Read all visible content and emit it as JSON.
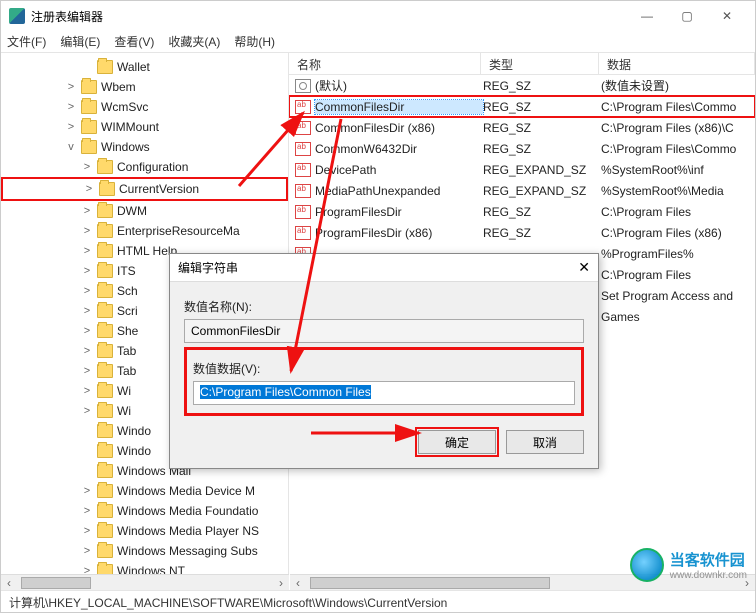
{
  "window": {
    "title": "注册表编辑器"
  },
  "menu": {
    "file": "文件(F)",
    "edit": "编辑(E)",
    "view": "查看(V)",
    "fav": "收藏夹(A)",
    "help": "帮助(H)"
  },
  "tree": [
    {
      "ind": 5,
      "tw": "",
      "label": "Wallet"
    },
    {
      "ind": 4,
      "tw": ">",
      "label": "Wbem"
    },
    {
      "ind": 4,
      "tw": ">",
      "label": "WcmSvc"
    },
    {
      "ind": 4,
      "tw": ">",
      "label": "WIMMount"
    },
    {
      "ind": 4,
      "tw": "v",
      "label": "Windows"
    },
    {
      "ind": 5,
      "tw": ">",
      "label": "Configuration"
    },
    {
      "ind": 5,
      "tw": ">",
      "label": "CurrentVersion",
      "sel": true
    },
    {
      "ind": 5,
      "tw": ">",
      "label": "DWM"
    },
    {
      "ind": 5,
      "tw": ">",
      "label": "EnterpriseResourceMa"
    },
    {
      "ind": 5,
      "tw": ">",
      "label": "HTML Help"
    },
    {
      "ind": 5,
      "tw": ">",
      "label": "ITS"
    },
    {
      "ind": 5,
      "tw": ">",
      "label": "Sch"
    },
    {
      "ind": 5,
      "tw": ">",
      "label": "Scri"
    },
    {
      "ind": 5,
      "tw": ">",
      "label": "She"
    },
    {
      "ind": 5,
      "tw": ">",
      "label": "Tab"
    },
    {
      "ind": 5,
      "tw": ">",
      "label": "Tab"
    },
    {
      "ind": 5,
      "tw": ">",
      "label": "Wi"
    },
    {
      "ind": 5,
      "tw": ">",
      "label": "Wi"
    },
    {
      "ind": 5,
      "tw": "",
      "label": "Windo"
    },
    {
      "ind": 5,
      "tw": "",
      "label": "Windo"
    },
    {
      "ind": 5,
      "tw": "",
      "label": "Windows Mail"
    },
    {
      "ind": 5,
      "tw": ">",
      "label": "Windows Media Device M"
    },
    {
      "ind": 5,
      "tw": ">",
      "label": "Windows Media Foundatio"
    },
    {
      "ind": 5,
      "tw": ">",
      "label": "Windows Media Player NS"
    },
    {
      "ind": 5,
      "tw": ">",
      "label": "Windows Messaging Subs"
    },
    {
      "ind": 5,
      "tw": ">",
      "label": "Windows NT"
    }
  ],
  "list": {
    "head": {
      "name": "名称",
      "type": "类型",
      "data": "数据"
    },
    "rows": [
      {
        "def": true,
        "name": "(默认)",
        "type": "REG_SZ",
        "data": "(数值未设置)"
      },
      {
        "name": "CommonFilesDir",
        "type": "REG_SZ",
        "data": "C:\\Program Files\\Commo",
        "hl": true,
        "boxed": true
      },
      {
        "name": "CommonFilesDir (x86)",
        "type": "REG_SZ",
        "data": "C:\\Program Files (x86)\\C"
      },
      {
        "name": "CommonW6432Dir",
        "type": "REG_SZ",
        "data": "C:\\Program Files\\Commo"
      },
      {
        "name": "DevicePath",
        "type": "REG_EXPAND_SZ",
        "data": "%SystemRoot%\\inf"
      },
      {
        "name": "MediaPathUnexpanded",
        "type": "REG_EXPAND_SZ",
        "data": "%SystemRoot%\\Media"
      },
      {
        "name": "ProgramFilesDir",
        "type": "REG_SZ",
        "data": "C:\\Program Files"
      },
      {
        "name": "ProgramFilesDir (x86)",
        "type": "REG_SZ",
        "data": "C:\\Program Files (x86)"
      },
      {
        "name": "",
        "type": "",
        "data": "%ProgramFiles%"
      },
      {
        "name": "",
        "type": "",
        "data": "C:\\Program Files"
      },
      {
        "name": "",
        "type": "",
        "data": "Set Program Access and"
      },
      {
        "name": "",
        "type": "",
        "data": "Games"
      }
    ]
  },
  "dialog": {
    "title": "编辑字符串",
    "name_label": "数值名称(N):",
    "name_value": "CommonFilesDir",
    "data_label": "数值数据(V):",
    "data_value": "C:\\Program Files\\Common Files",
    "ok": "确定",
    "cancel": "取消"
  },
  "status": "计算机\\HKEY_LOCAL_MACHINE\\SOFTWARE\\Microsoft\\Windows\\CurrentVersion",
  "watermark": {
    "brand": "当客软件园",
    "url": "www.downkr.com"
  }
}
